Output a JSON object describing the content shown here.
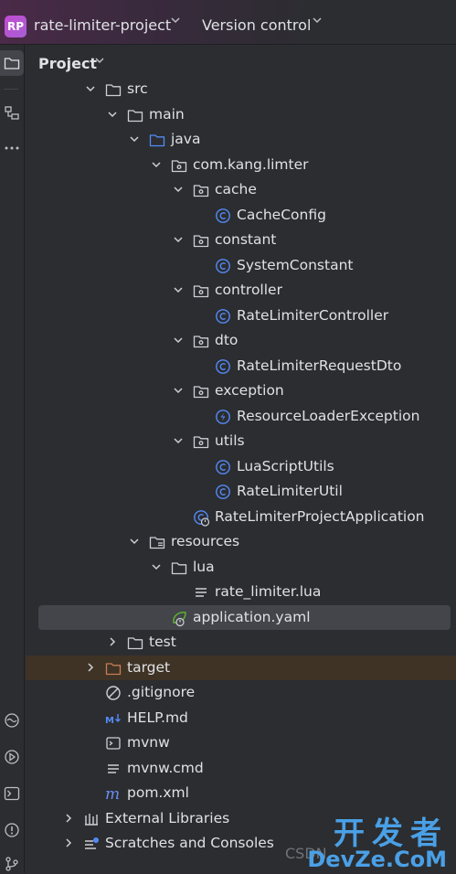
{
  "titlebar": {
    "project_badge": "RP",
    "project_name": "rate-limiter-project",
    "vcs_label": "Version control"
  },
  "panel": {
    "title": "Project"
  },
  "tree": [
    {
      "label": "src",
      "icon": "folder",
      "expanded": true
    },
    {
      "label": "main",
      "icon": "folder",
      "expanded": true
    },
    {
      "label": "java",
      "icon": "folder-source",
      "expanded": true
    },
    {
      "label": "com.kang.limter",
      "icon": "package",
      "expanded": true
    },
    {
      "label": "cache",
      "icon": "package",
      "expanded": true
    },
    {
      "label": "CacheConfig",
      "icon": "class"
    },
    {
      "label": "constant",
      "icon": "package",
      "expanded": true
    },
    {
      "label": "SystemConstant",
      "icon": "class"
    },
    {
      "label": "controller",
      "icon": "package",
      "expanded": true
    },
    {
      "label": "RateLimiterController",
      "icon": "class"
    },
    {
      "label": "dto",
      "icon": "package",
      "expanded": true
    },
    {
      "label": "RateLimiterRequestDto",
      "icon": "class"
    },
    {
      "label": "exception",
      "icon": "package",
      "expanded": true
    },
    {
      "label": "ResourceLoaderException",
      "icon": "exception-class"
    },
    {
      "label": "utils",
      "icon": "package",
      "expanded": true
    },
    {
      "label": "LuaScriptUtils",
      "icon": "class"
    },
    {
      "label": "RateLimiterUtil",
      "icon": "class"
    },
    {
      "label": "RateLimiterProjectApplication",
      "icon": "spring-boot-class"
    },
    {
      "label": "resources",
      "icon": "folder-resources",
      "expanded": true
    },
    {
      "label": "lua",
      "icon": "folder",
      "expanded": true
    },
    {
      "label": "rate_limiter.lua",
      "icon": "text-file"
    },
    {
      "label": "application.yaml",
      "icon": "spring-yaml",
      "selected": true
    },
    {
      "label": "test",
      "icon": "folder",
      "expanded": false
    },
    {
      "label": "target",
      "icon": "folder-excluded",
      "expanded": false,
      "excluded": true
    },
    {
      "label": ".gitignore",
      "icon": "ignore-file"
    },
    {
      "label": "HELP.md",
      "icon": "markdown-file"
    },
    {
      "label": "mvnw",
      "icon": "shell-file"
    },
    {
      "label": "mvnw.cmd",
      "icon": "text-file"
    },
    {
      "label": "pom.xml",
      "icon": "maven-file"
    },
    {
      "label": "External Libraries",
      "icon": "libraries",
      "expanded": false
    },
    {
      "label": "Scratches and Consoles",
      "icon": "scratches",
      "expanded": false
    }
  ],
  "watermark": {
    "csdn": "CSDN",
    "cn": "开发者",
    "en": "DevZe.CoM"
  },
  "colors": {
    "accent": "#3574f0",
    "class_icon": "#548af7",
    "folder_excluded": "#c77d55",
    "maven": "#6b8df2"
  }
}
